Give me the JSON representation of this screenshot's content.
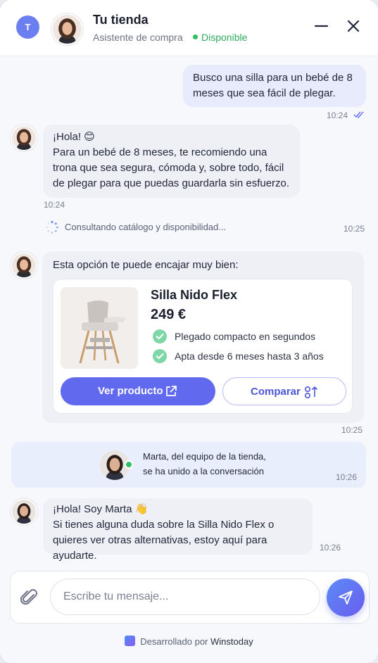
{
  "header": {
    "user_initial": "T",
    "title": "Tu tienda",
    "subtitle": "Asistente de compra",
    "status": "Disponible"
  },
  "messages": [
    {
      "id": "user-1",
      "text": "Busco una silla para un bebé de 8 meses que sea fácil de plegar.",
      "time": "10:24"
    },
    {
      "id": "bot-1",
      "line1": "¡Hola! 😊",
      "line2": "Para un bebé de 8 meses, te recomiendo una trona que sea segura, cómoda y, sobre todo, fácil de plegar para que puedas guardarla sin esfuerzo.",
      "time": "10:24"
    }
  ],
  "consulting": {
    "text": "Consultando catálogo y disponibilidad...",
    "time": "10:25"
  },
  "product_card": {
    "intro": "Esta opción te puede encajar muy bien:",
    "name": "Silla Nido Flex",
    "price": "249 €",
    "features": [
      "Plegado compacto en segundos",
      "Apta desde 6 meses hasta 3 años"
    ],
    "primary_label": "Ver producto",
    "secondary_label": "Comparar",
    "time": "10:25"
  },
  "join": {
    "line1": "Marta, del equipo de la tienda,",
    "line2": "se ha unido a la conversación",
    "time": "10:26"
  },
  "agent_message": {
    "line1": "¡Hola! Soy Marta 👋",
    "line2": "Si tienes alguna duda sobre la Silla Nido Flex o quieres ver otras alternativas, estoy aquí para ayudarte.",
    "time": "10:26"
  },
  "composer": {
    "placeholder": "Escribe tu mensaje..."
  },
  "footer": {
    "prefix": "Desarrollado por",
    "brand": "Winstoday"
  },
  "colors": {
    "accent": "#6169ee",
    "online": "#2fbf63",
    "user_bubble": "#e8ebfb",
    "bot_bubble": "#eef0f6"
  }
}
